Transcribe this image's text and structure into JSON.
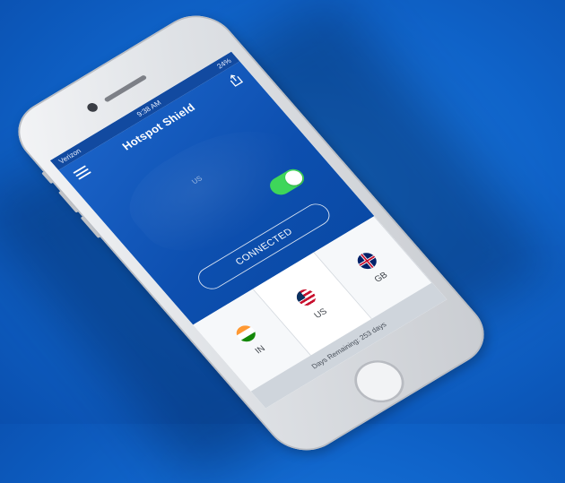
{
  "status_bar": {
    "carrier": "Verizon",
    "time": "9:38 AM",
    "battery": "24%"
  },
  "app": {
    "title": "Hotspot Shield",
    "map_label": "US"
  },
  "vpn": {
    "toggle_on": true,
    "status_text": "CONNECTED",
    "toggle_color": "#3ed65a"
  },
  "countries": [
    {
      "code": "IN",
      "flag": "flag-india-icon"
    },
    {
      "code": "US",
      "flag": "flag-usa-icon"
    },
    {
      "code": "GB",
      "flag": "flag-uk-icon"
    }
  ],
  "footer": {
    "days_remaining": "Days Remaining: 253 days"
  },
  "colors": {
    "background": "#0f63c9",
    "app_blue": "#0d4faf",
    "accent_green": "#3ed65a"
  }
}
